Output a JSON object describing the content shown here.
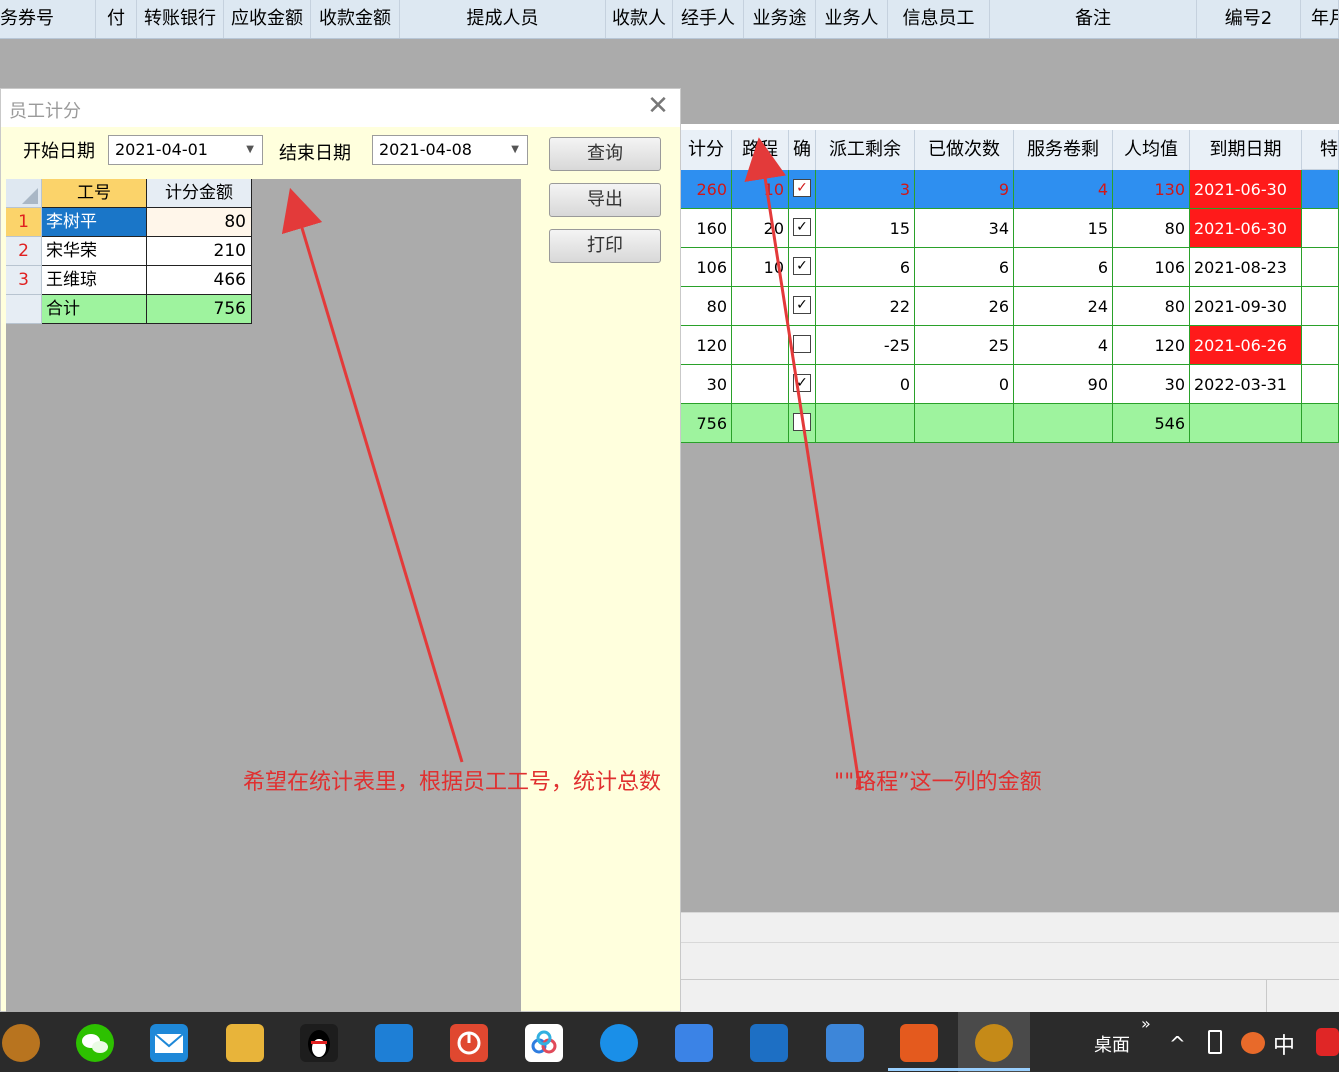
{
  "top_header": {
    "columns": [
      "务券号",
      "付",
      "转账银行",
      "应收金额",
      "收款金额",
      "提成人员",
      "收款人",
      "经手人",
      "业务途",
      "业务人",
      "信息员工",
      "备注",
      "编号2",
      "年月"
    ]
  },
  "bg_grid": {
    "headers": [
      "计分",
      "路程",
      "确",
      "派工剩余",
      "已做次数",
      "服务卷剩",
      "人均值",
      "到期日期",
      "特"
    ],
    "rows": [
      {
        "score": "260",
        "route": "10",
        "checked": true,
        "remain": "3",
        "done": "9",
        "service": "4",
        "avg": "130",
        "date": "2021-06-30",
        "date_red": true,
        "selected": true
      },
      {
        "score": "160",
        "route": "20",
        "checked": true,
        "remain": "15",
        "done": "34",
        "service": "15",
        "avg": "80",
        "date": "2021-06-30",
        "date_red": true,
        "selected": false
      },
      {
        "score": "106",
        "route": "10",
        "checked": true,
        "remain": "6",
        "done": "6",
        "service": "6",
        "avg": "106",
        "date": "2021-08-23",
        "date_red": false,
        "selected": false
      },
      {
        "score": "80",
        "route": "",
        "checked": true,
        "remain": "22",
        "done": "26",
        "service": "24",
        "avg": "80",
        "date": "2021-09-30",
        "date_red": false,
        "selected": false
      },
      {
        "score": "120",
        "route": "",
        "checked": false,
        "remain": "-25",
        "done": "25",
        "service": "4",
        "avg": "120",
        "date": "2021-06-26",
        "date_red": true,
        "selected": false
      },
      {
        "score": "30",
        "route": "",
        "checked": true,
        "remain": "0",
        "done": "0",
        "service": "90",
        "avg": "30",
        "date": "2022-03-31",
        "date_red": false,
        "selected": false
      }
    ],
    "total": {
      "score": "756",
      "avg": "546"
    }
  },
  "dialog": {
    "title": "员工计分",
    "close_symbol": "✕",
    "start_label": "开始日期",
    "start_value": "2021-04-01",
    "end_label": "结束日期",
    "end_value": "2021-04-08",
    "query_label": "查询",
    "export_label": "导出",
    "print_label": "打印",
    "grid": {
      "col_id": "工号",
      "col_amount": "计分金额",
      "rows": [
        {
          "num": "1",
          "name": "李树平",
          "amount": "80"
        },
        {
          "num": "2",
          "name": "宋华荣",
          "amount": "210"
        },
        {
          "num": "3",
          "name": "王维琼",
          "amount": "466"
        }
      ],
      "total_label": "合计",
      "total_amount": "756"
    }
  },
  "annotations": {
    "left": "希望在统计表里，根据员工工号，统计总数",
    "right": "\"\"路程”这一列的金额"
  },
  "taskbar": {
    "desktop_label": "桌面",
    "more": "»",
    "caret": "^",
    "ime": "中",
    "icons": [
      "acorn-icon",
      "wechat-icon",
      "mail-icon",
      "files-icon",
      "qq-icon",
      "calendar-icon",
      "power-app-icon",
      "baidu-netdisk-icon",
      "feishu-icon",
      "dingtalk-icon",
      "rx-app-icon",
      "tax-app-icon",
      "fox-app-icon",
      "game-app-icon"
    ]
  }
}
